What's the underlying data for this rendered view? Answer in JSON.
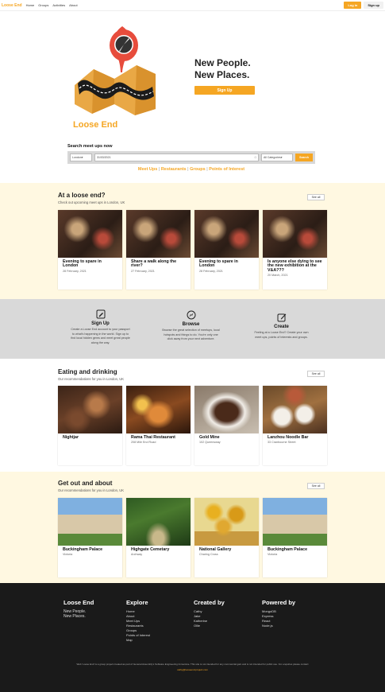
{
  "nav": {
    "brand": "Loose End",
    "links": [
      "Home",
      "Groups",
      "Activities",
      "About"
    ],
    "login": "Log in",
    "signup": "Sign up"
  },
  "hero": {
    "brand": "Loose End",
    "line1": "New People.",
    "line2": "New Places.",
    "signup": "Sign Up"
  },
  "search": {
    "label": "Search meet ups now",
    "location": "London",
    "date": "31/03/2021",
    "category": "All Categories",
    "button": "Search",
    "quick_links": [
      "Meet Ups",
      "Restaurants",
      "Groups",
      "Points of Interest"
    ]
  },
  "loose_end": {
    "title": "At a loose end?",
    "subtitle": "Check out upcoming meet ups in London, UK",
    "see_all": "See all",
    "cards": [
      {
        "title": "Evening to spare in London",
        "sub": "28 February, 2021"
      },
      {
        "title": "Share a walk along the river?",
        "sub": "27 February, 2021"
      },
      {
        "title": "Evening to spare in London",
        "sub": "28 February, 2021"
      },
      {
        "title": "Is anyone else dying to see the new exhibition at the V&A???",
        "sub": "20 March, 2021"
      }
    ]
  },
  "features": [
    {
      "title": "Sign Up",
      "desc": "Create a Loose End account to your passport to what's happening in the world. Sign up to find local hidden gems and meet great people along the way."
    },
    {
      "title": "Browse",
      "desc": "Browse the great selection of meetups, local hotspots and things to do. You're only one click away from your next adventure."
    },
    {
      "title": "Create",
      "desc": "Feeling at a Loose End? Create your own meet ups, points of interests and groups."
    }
  ],
  "eating": {
    "title": "Eating and drinking",
    "subtitle": "Our recommendations for you in London, UK",
    "see_all": "See all",
    "cards": [
      {
        "title": "Nightjar",
        "sub": ""
      },
      {
        "title": "Rama Thai Restaurant",
        "sub": "208 Mile End Road"
      },
      {
        "title": "Gold Mine",
        "sub": "102 Queensway"
      },
      {
        "title": "Lanzhou Noodle Bar",
        "sub": "33 Cranbourne Street"
      }
    ]
  },
  "out": {
    "title": "Get out and about",
    "subtitle": "Our recommendations for you in London, UK",
    "see_all": "See all",
    "cards": [
      {
        "title": "Buckingham Palace",
        "sub": "Victoria"
      },
      {
        "title": "Highgate Cemetary",
        "sub": "Archway"
      },
      {
        "title": "National Gallery",
        "sub": "Charing Cross"
      },
      {
        "title": "Buckingham Palace",
        "sub": "Victoria"
      }
    ]
  },
  "footer": {
    "brand": "Loose End",
    "tag1": "New People.",
    "tag2": "New Places.",
    "explore_head": "Explore",
    "explore": [
      "Home",
      "About",
      "Meet Ups",
      "Restaurants",
      "Groups",
      "Points of Interest",
      "Map"
    ],
    "created_head": "Created by",
    "created": [
      "Cathy",
      "Jake",
      "Katherine",
      "Ollie"
    ],
    "powered_head": "Powered by",
    "powered": [
      "MongoDB",
      "Express",
      "React",
      "Node.js"
    ],
    "copyright": "Web 'Loose End' is a group project created as part of General Assembly's Software Engineering Immersive. This site is not intended for any commercial gain and is not intended for public use. For enquiries please contact",
    "copyright2": "cathy@looseend.project.com"
  },
  "colors": {
    "accent": "#f5a623",
    "cream": "#fff8e1",
    "grey": "#d9d9d9",
    "footer": "#1a1a1a"
  }
}
